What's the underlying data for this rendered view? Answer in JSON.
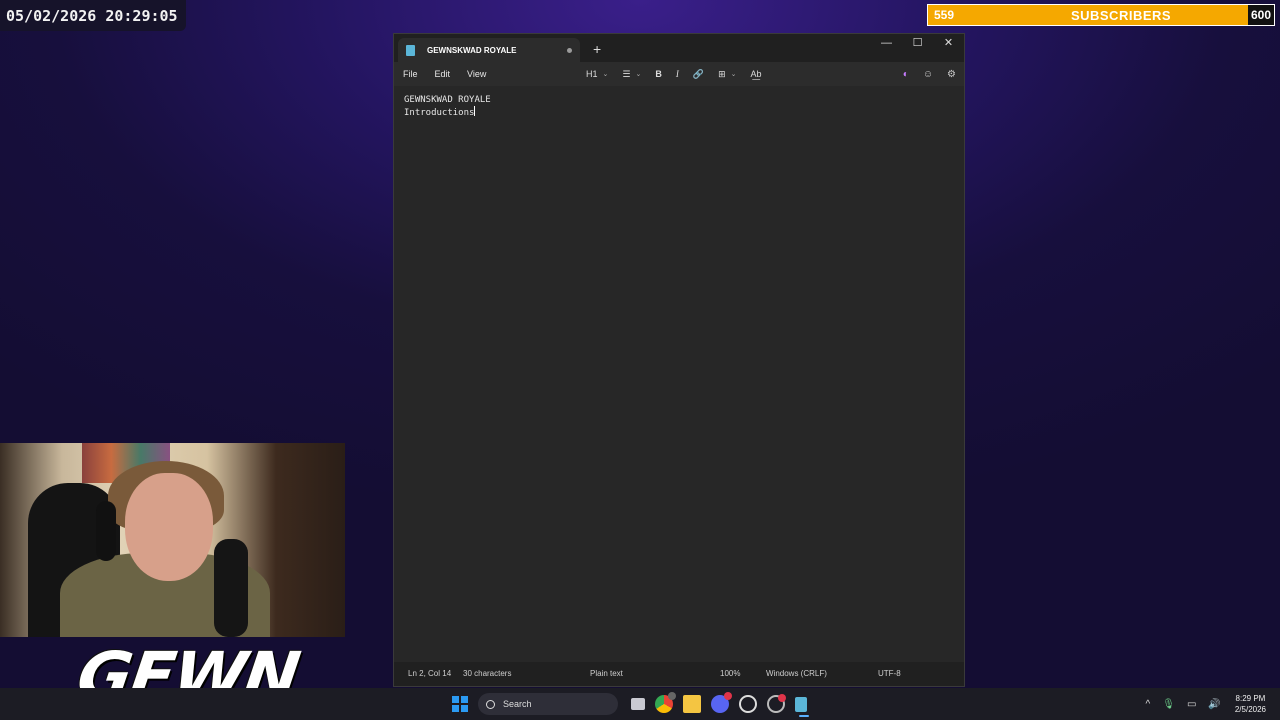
{
  "overlay": {
    "datetime": "05/02/2026 20:29:05",
    "subscribers": {
      "current": "559",
      "label": "SUBSCRIBERS",
      "goal": "600",
      "progress": 0.93
    },
    "logo_text": "GEWN"
  },
  "notepad": {
    "tab_title": "GEWNSKWAD ROYALE",
    "new_tab": "+",
    "controls": {
      "minimize": "—",
      "maximize": "☐",
      "close": "✕"
    },
    "menu": [
      "File",
      "Edit",
      "View"
    ],
    "toolbar": {
      "heading": "H1",
      "list": "☰",
      "bold": "B",
      "italic": "I",
      "link": "🔗",
      "table": "⊞",
      "spell": "A͟b",
      "copilot": "◐",
      "account": "☺",
      "settings": "⚙"
    },
    "content": {
      "line1": "GEWNSKWAD ROYALE",
      "line2": "Introductions"
    },
    "status": {
      "position": "Ln 2, Col 14",
      "characters": "30 characters",
      "format": "Plain text",
      "zoom": "100%",
      "line_endings": "Windows (CRLF)",
      "encoding": "UTF-8"
    }
  },
  "taskbar": {
    "search_placeholder": "Search",
    "clock_time": "8:29 PM",
    "clock_date": "2/5/2026",
    "tray": {
      "chevron": "^",
      "mic": "🎙",
      "network": "▭",
      "volume": "🔊"
    }
  }
}
